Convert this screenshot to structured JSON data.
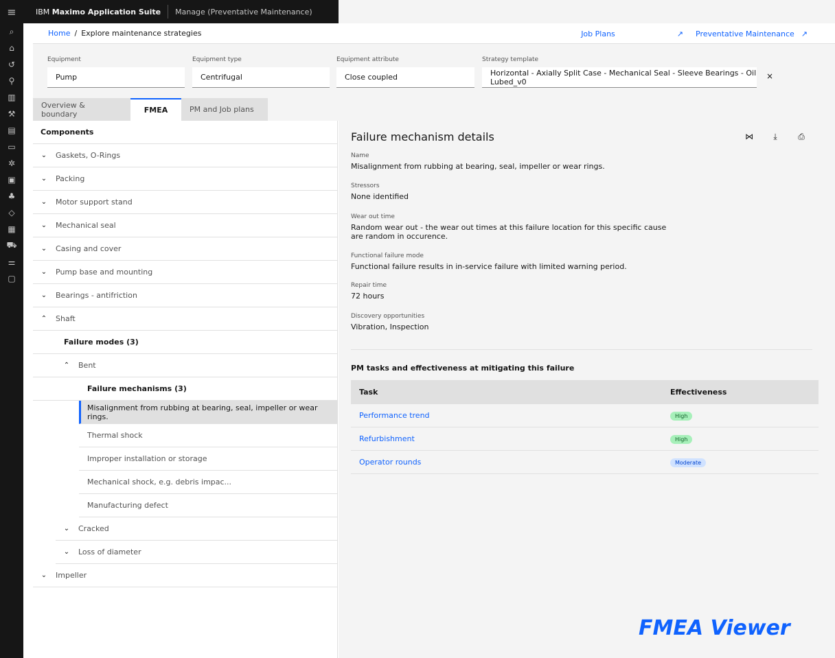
{
  "header": {
    "brand_prefix": "IBM ",
    "brand_name": "Maximo Application Suite",
    "app_name": "Manage (Preventative Maintenance)"
  },
  "breadcrumb": {
    "home": "Home",
    "separator": "/",
    "current": "Explore maintenance strategies"
  },
  "links": {
    "job_plans": "Job Plans",
    "preventative_maintenance": "Preventative Maintenance"
  },
  "filters": {
    "equipment": {
      "label": "Equipment",
      "value": "Pump"
    },
    "equipment_type": {
      "label": "Equipment type",
      "value": "Centrifugal"
    },
    "equipment_attribute": {
      "label": "Equipment attribute",
      "value": "Close coupled"
    },
    "strategy_template": {
      "label": "Strategy template",
      "value": "Horizontal - Axially Split Case - Mechanical Seal - Sleeve Bearings - Oil Lubed_v0"
    }
  },
  "tabs": {
    "overview": "Overview & boundary",
    "fmea": "FMEA",
    "pm": "PM and Job plans"
  },
  "components": {
    "header": "Components",
    "items": [
      "Gaskets, O-Rings",
      "Packing",
      "Motor support stand",
      "Mechanical seal",
      "Casing and cover",
      "Pump base and mounting",
      "Bearings - antifriction",
      "Shaft"
    ],
    "failure_modes_header": "Failure modes (3)",
    "mode_bent": "Bent",
    "mechanisms_header": "Failure mechanisms (3)",
    "mechanisms": [
      "Misalignment from rubbing at bearing, seal, impeller or wear rings.",
      "Thermal shock",
      "Improper installation or storage",
      "Mechanical shock, e.g. debris impac...",
      "Manufacturing defect"
    ],
    "mode_cracked": "Cracked",
    "mode_loss": "Loss of diameter",
    "impeller": "Impeller"
  },
  "details": {
    "title": "Failure mechanism details",
    "name_label": "Name",
    "name_value": "Misalignment from rubbing at bearing, seal, impeller or wear rings.",
    "stressors_label": "Stressors",
    "stressors_value": "None identified",
    "wear_label": "Wear out time",
    "wear_value": "Random wear out - the wear out times at this failure location for this specific cause are random in occurence.",
    "ffm_label": "Functional failure mode",
    "ffm_value": "Functional failure results in in-service failure with limited warning period.",
    "repair_label": "Repair time",
    "repair_value": "72 hours",
    "discovery_label": "Discovery opportunities",
    "discovery_value": "Vibration, Inspection"
  },
  "pm_tasks": {
    "title": "PM tasks and effectiveness at mitigating this failure",
    "col_task": "Task",
    "col_effectiveness": "Effectiveness",
    "rows": [
      {
        "task": "Performance trend",
        "effectiveness": "High"
      },
      {
        "task": "Refurbishment",
        "effectiveness": "High"
      },
      {
        "task": "Operator rounds",
        "effectiveness": "Moderate"
      }
    ]
  },
  "watermark": "FMEA Viewer"
}
